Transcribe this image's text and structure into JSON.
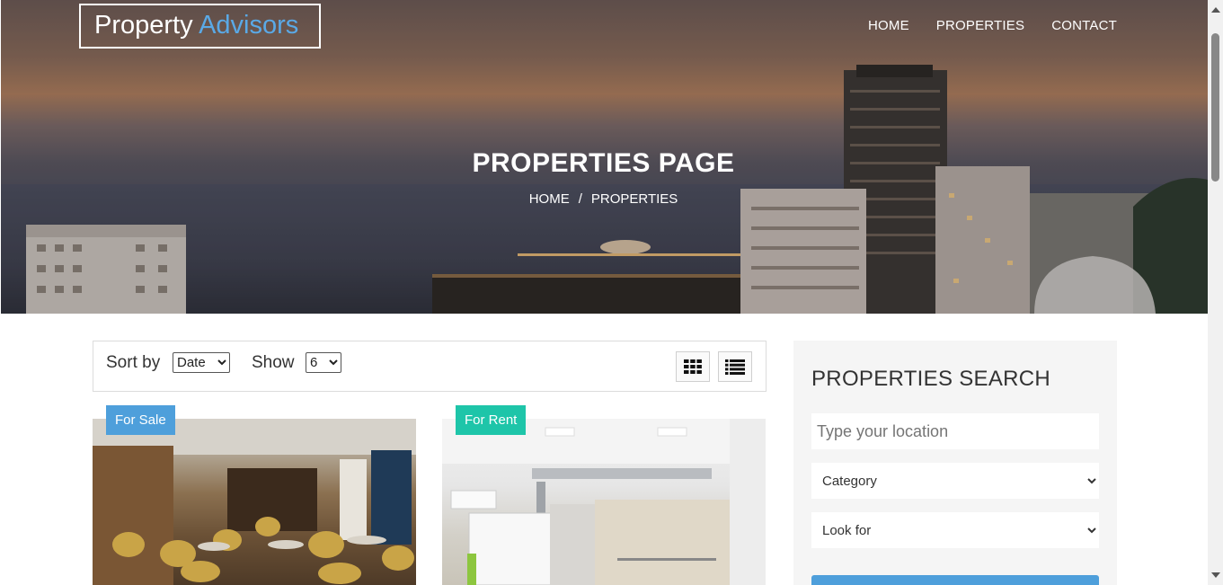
{
  "brand": {
    "name_part1": "Property",
    "name_part2": "Advisors",
    "accent_color": "#5aa9e6"
  },
  "nav": {
    "items": [
      "HOME",
      "PROPERTIES",
      "CONTACT"
    ]
  },
  "hero": {
    "title": "PROPERTIES PAGE",
    "breadcrumb": [
      "HOME",
      "/",
      "PROPERTIES"
    ]
  },
  "toolbar": {
    "sort_label": "Sort by",
    "sort_value": "Date",
    "show_label": "Show",
    "show_value": "6",
    "grid_icon": "grid-view-icon",
    "list_icon": "list-view-icon"
  },
  "listings": [
    {
      "badge": "For Sale",
      "badge_color": "#4e9fdb",
      "image": "cafe-interior"
    },
    {
      "badge": "For Rent",
      "badge_color": "#1ec5a9",
      "image": "office-interior"
    }
  ],
  "sidebar": {
    "title": "PROPERTIES SEARCH",
    "location_placeholder": "Type your location",
    "category_value": "Category",
    "lookfor_value": "Look for",
    "button_color": "#4e9fdb"
  }
}
